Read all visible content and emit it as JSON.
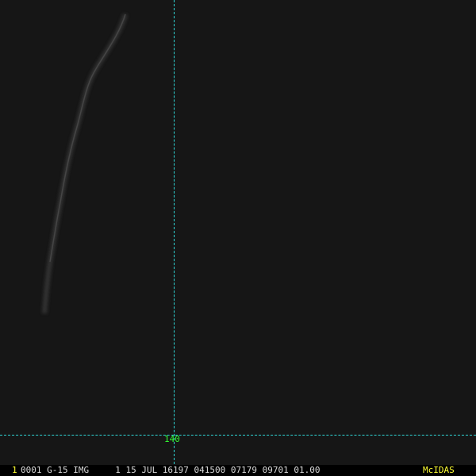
{
  "colors": {
    "background": "#161616",
    "grid_line": "#2fd6d6",
    "grid_label": "#33ff33",
    "status_text": "#d8d8d8",
    "accent": "#ffff33"
  },
  "grid": {
    "longitude_label": "140"
  },
  "status_bar": {
    "frame_number": "1",
    "text": "0001 G-15 IMG     1 15 JUL 16197 041500 07179 09701 01.00",
    "brand": "McIDAS"
  }
}
